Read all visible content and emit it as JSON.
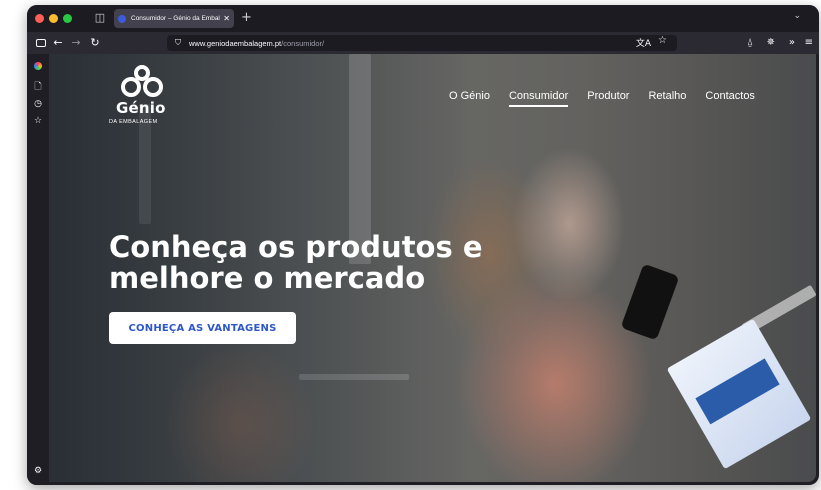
{
  "browser": {
    "tab": {
      "title": "Consumidor – Génio da Embalagem",
      "close_glyph": "✕"
    },
    "new_tab_glyph": "+",
    "url": {
      "host": "www.geniodaembalagem.pt",
      "path": "/consumidor/"
    },
    "icons": {
      "sidebar_toggle": "sidebar-icon",
      "back": "←",
      "forward": "→",
      "reload": "↻",
      "shield": "⛉",
      "translate": "文A",
      "bookmark_star": "☆",
      "extensions": "⍙",
      "puzzle": "✵",
      "overflow": "»",
      "menu": "≡",
      "tabs_menu": "⌄",
      "tab_list": "◫"
    },
    "sidebar": {
      "ai": "ai-chatbot-icon",
      "synced_tabs": "🗋",
      "history": "◷",
      "bookmarks": "☆",
      "settings": "⚙"
    }
  },
  "site": {
    "logo": {
      "word": "Génio",
      "subtitle": "DA EMBALAGEM"
    },
    "nav": [
      {
        "label": "O Génio",
        "active": false
      },
      {
        "label": "Consumidor",
        "active": true
      },
      {
        "label": "Produtor",
        "active": false
      },
      {
        "label": "Retalho",
        "active": false
      },
      {
        "label": "Contactos",
        "active": false
      }
    ],
    "hero": {
      "line1": "Conheça os produtos e",
      "line2": "melhore o mercado",
      "cta": "CONHEÇA AS VANTAGENS"
    }
  },
  "colors": {
    "cta_text": "#2f58c7",
    "browser_chrome": "#2b2a33"
  }
}
